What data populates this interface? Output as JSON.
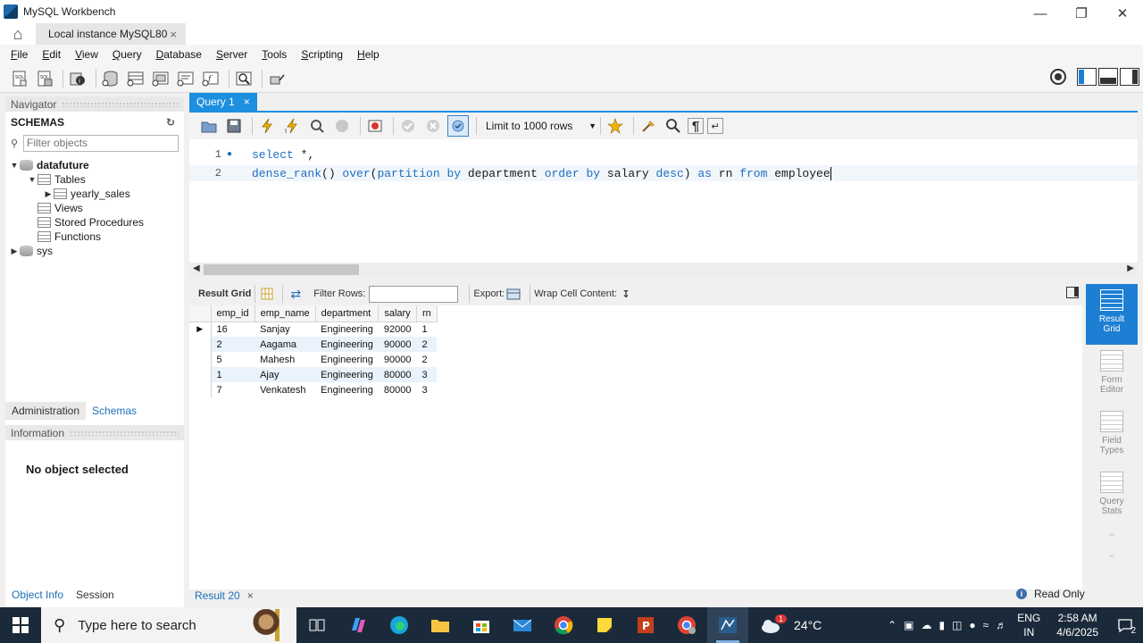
{
  "window": {
    "title": "MySQL Workbench"
  },
  "connection_tab": {
    "label": "Local instance MySQL80"
  },
  "menu": [
    {
      "label": "File",
      "key": "F",
      "rest": "ile"
    },
    {
      "label": "Edit",
      "key": "E",
      "rest": "dit"
    },
    {
      "label": "View",
      "key": "V",
      "rest": "iew"
    },
    {
      "label": "Query",
      "key": "Q",
      "rest": "uery"
    },
    {
      "label": "Database",
      "key": "D",
      "rest": "atabase"
    },
    {
      "label": "Server",
      "key": "S",
      "rest": "erver"
    },
    {
      "label": "Tools",
      "key": "T",
      "rest": "ools"
    },
    {
      "label": "Scripting",
      "key": "S",
      "rest": "cripting"
    },
    {
      "label": "Help",
      "key": "H",
      "rest": "elp"
    }
  ],
  "navigator": {
    "header": "Navigator",
    "schemas_title": "SCHEMAS",
    "filter_placeholder": "Filter objects",
    "tree": {
      "db1": "datafuture",
      "tables": "Tables",
      "table1": "yearly_sales",
      "views": "Views",
      "procedures": "Stored Procedures",
      "functions": "Functions",
      "db2": "sys"
    },
    "tabs": {
      "administration": "Administration",
      "schemas": "Schemas"
    },
    "info_header": "Information",
    "no_object": "No object selected",
    "bottom_tabs": {
      "object_info": "Object Info",
      "session": "Session"
    }
  },
  "query": {
    "tab_label": "Query 1",
    "limit_label": "Limit to 1000 rows",
    "lines": [
      {
        "num": "1",
        "tokens": [
          {
            "t": "select",
            "k": true
          },
          {
            "t": " *,",
            "k": false
          }
        ]
      },
      {
        "num": "2",
        "tokens": [
          {
            "t": "dense_rank",
            "k": true
          },
          {
            "t": "() ",
            "k": false
          },
          {
            "t": "over",
            "k": true
          },
          {
            "t": "(",
            "k": false
          },
          {
            "t": "partition by",
            "k": true
          },
          {
            "t": " department ",
            "k": false
          },
          {
            "t": "order by",
            "k": true
          },
          {
            "t": " salary ",
            "k": false
          },
          {
            "t": "desc",
            "k": true
          },
          {
            "t": ") ",
            "k": false
          },
          {
            "t": "as",
            "k": true
          },
          {
            "t": " rn ",
            "k": false
          },
          {
            "t": "from",
            "k": true
          },
          {
            "t": " employee",
            "k": false
          }
        ]
      }
    ]
  },
  "result": {
    "grid_label": "Result Grid",
    "filter_label": "Filter Rows:",
    "export_label": "Export:",
    "wrap_label": "Wrap Cell Content:",
    "columns": [
      "emp_id",
      "emp_name",
      "department",
      "salary",
      "rn"
    ],
    "rows": [
      [
        "16",
        "Sanjay",
        "Engineering",
        "92000",
        "1"
      ],
      [
        "2",
        "Aagama",
        "Engineering",
        "90000",
        "2"
      ],
      [
        "5",
        "Mahesh",
        "Engineering",
        "90000",
        "2"
      ],
      [
        "1",
        "Ajay",
        "Engineering",
        "80000",
        "3"
      ],
      [
        "7",
        "Venkatesh",
        "Engineering",
        "80000",
        "3"
      ]
    ],
    "tab_label": "Result 20",
    "status": "Read Only"
  },
  "side_panel": {
    "result_grid": "Result Grid",
    "form_editor": "Form Editor",
    "field_types": "Field Types",
    "query_stats": "Query Stats"
  },
  "taskbar": {
    "search_placeholder": "Type here to search",
    "weather_temp": "24°C",
    "weather_badge": "1",
    "lang_top": "ENG",
    "lang_bottom": "IN",
    "time": "2:58 AM",
    "date": "4/6/2025",
    "notifications": "2"
  },
  "colors": {
    "accent": "#1c8fe0",
    "keyword": "#1f6fbf",
    "taskbar": "#1b2a3a"
  }
}
